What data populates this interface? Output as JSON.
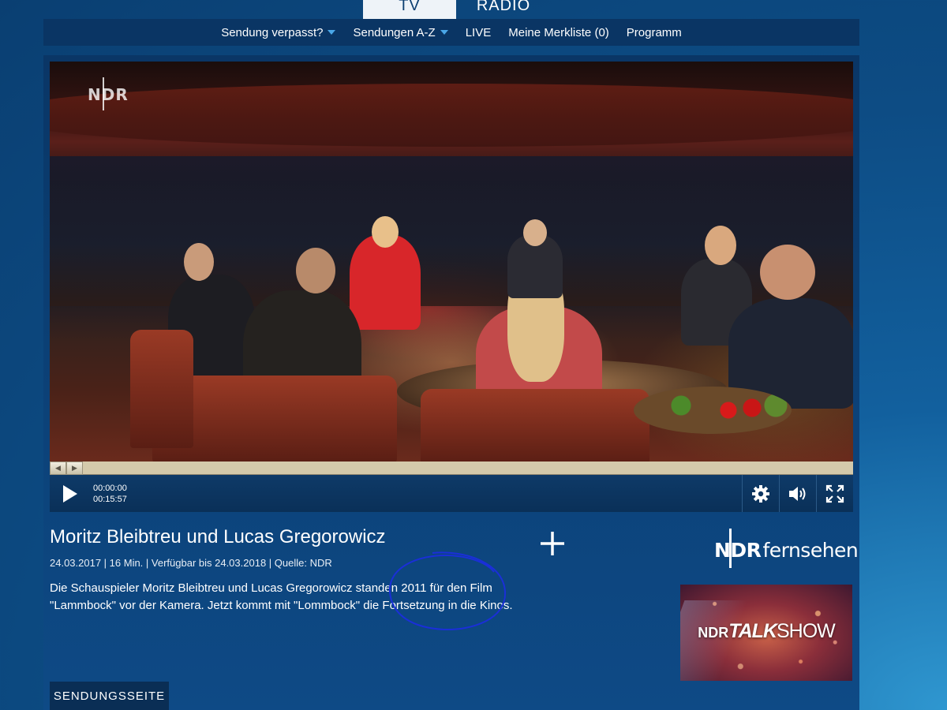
{
  "top_tabs": {
    "tv": "TV",
    "radio": "RADIO"
  },
  "nav": {
    "items": [
      {
        "label": "Sendung verpasst?",
        "has_dropdown": true
      },
      {
        "label": "Sendungen A-Z",
        "has_dropdown": true
      },
      {
        "label": "LIVE",
        "has_dropdown": false
      },
      {
        "label": "Meine Merkliste (0)",
        "has_dropdown": false
      },
      {
        "label": "Programm",
        "has_dropdown": false
      }
    ]
  },
  "player": {
    "channel_logo": "NDR",
    "current_time": "00:00:00",
    "duration": "00:15:57",
    "progress_fraction": 0.0,
    "icons": [
      "play-icon",
      "gear-icon",
      "volume-icon",
      "fullscreen-icon"
    ]
  },
  "video_info": {
    "title": "Moritz Bleibtreu und Lucas Gregorowicz",
    "meta": "24.03.2017 | 16 Min. | Verfügbar bis 24.03.2018 | Quelle: NDR",
    "description": "Die Schauspieler Moritz Bleibtreu und Lucas Gregorowicz standen 2011 für den Film \"Lammbock\" vor der Kamera. Jetzt kommt mit \"Lommbock\" die Fortsetzung in die Kinos."
  },
  "sidebar": {
    "brand_ndr": "NDR",
    "brand_name": "fernsehen",
    "show_thumb_small": "NDR",
    "show_thumb_big": "TALK",
    "show_thumb_rest": "SHOW"
  },
  "buttons": {
    "show_page": "SENDUNGSSEITE"
  },
  "colors": {
    "background": "#0d4c84",
    "nav": "#0a3564",
    "accent": "#4aa7e8",
    "annotation": "#1a2fd8"
  }
}
